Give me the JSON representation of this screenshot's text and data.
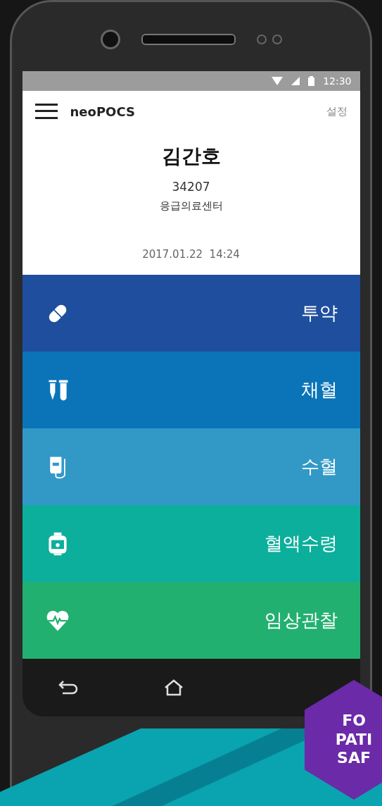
{
  "status_bar": {
    "time": "12:30"
  },
  "app_bar": {
    "title": "neoPOCS",
    "action": "설정"
  },
  "user": {
    "name": "김간호",
    "id": "34207",
    "department": "응급의료센터",
    "datetime": "2017.01.22  14:24"
  },
  "menu": [
    {
      "label": "투약",
      "color": "#1f4e9e",
      "kind": "pill"
    },
    {
      "label": "채혈",
      "color": "#0b74b8",
      "kind": "blood-draw"
    },
    {
      "label": "수혈",
      "color": "#3299c7",
      "kind": "transfusion"
    },
    {
      "label": "혈액수령",
      "color": "#0caf9b",
      "kind": "blood-bag"
    },
    {
      "label": "임상관찰",
      "color": "#22b071",
      "kind": "heart-rate"
    }
  ],
  "badge": {
    "lines": [
      "FO",
      "PATI",
      "SAF"
    ]
  }
}
